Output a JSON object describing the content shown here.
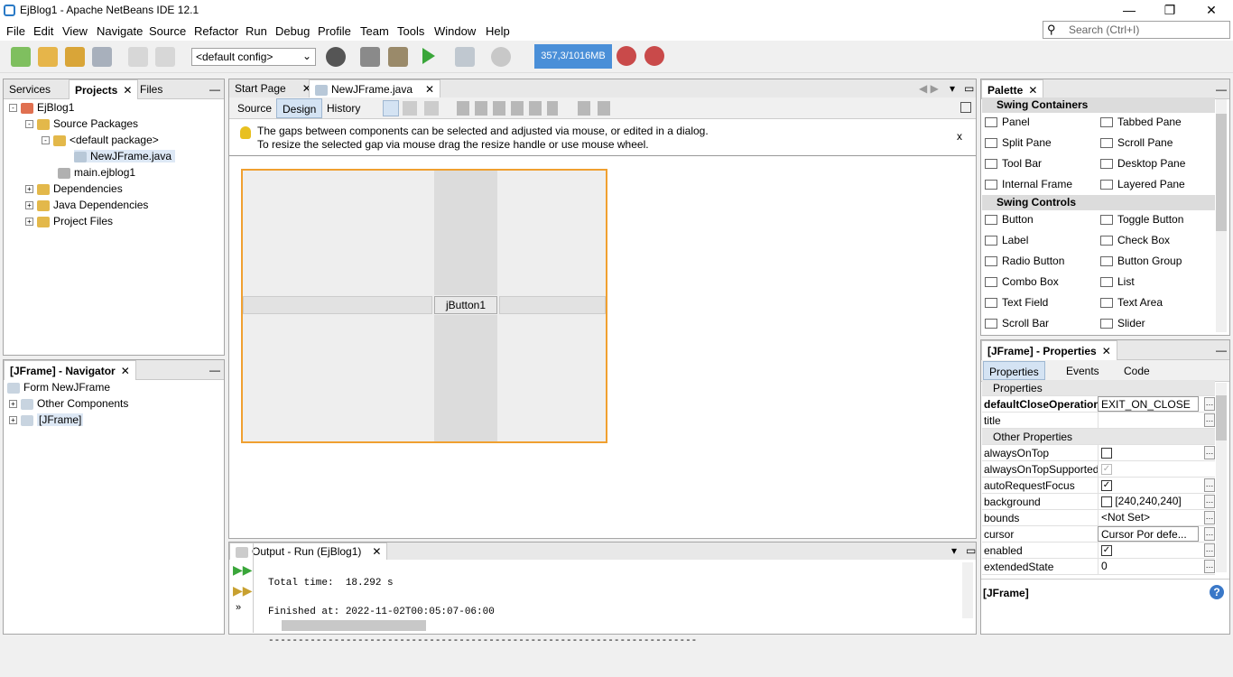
{
  "window": {
    "title": "EjBlog1 - Apache NetBeans IDE 12.1",
    "minimize": "—",
    "restore": "❐",
    "close": "✕"
  },
  "menu": [
    "File",
    "Edit",
    "View",
    "Navigate",
    "Source",
    "Refactor",
    "Run",
    "Debug",
    "Profile",
    "Team",
    "Tools",
    "Window",
    "Help"
  ],
  "search": {
    "placeholder": "Search (Ctrl+I)"
  },
  "toolbar": {
    "config": "<default config>",
    "memory": "357,3/1016MB"
  },
  "projects_panel": {
    "tabs": [
      "Services",
      "Projects",
      "Files"
    ],
    "tree": [
      "EjBlog1",
      "Source Packages",
      "<default package>",
      "NewJFrame.java",
      "main.ejblog1",
      "Dependencies",
      "Java Dependencies",
      "Project Files"
    ]
  },
  "navigator": {
    "title": "[JFrame] - Navigator",
    "tree": [
      "Form NewJFrame",
      "Other Components",
      "[JFrame]"
    ]
  },
  "editor": {
    "tabs": [
      "Start Page",
      "NewJFrame.java"
    ],
    "modes": [
      "Source",
      "Design",
      "History"
    ],
    "hint1": "The gaps between components can be selected and adjusted via mouse, or edited in a dialog.",
    "hint2": "To resize the selected gap via mouse drag the resize handle or use mouse wheel.",
    "hint_close": "x",
    "button": "jButton1"
  },
  "output": {
    "title": "Output - Run (EjBlog1)",
    "lines": [
      "Total time:  18.292 s",
      "Finished at: 2022-11-02T00:05:07-06:00",
      "------------------------------------------------------------------------"
    ]
  },
  "palette": {
    "title": "Palette",
    "cat1": "Swing Containers",
    "containers": [
      "Panel",
      "Tabbed Pane",
      "Split Pane",
      "Scroll Pane",
      "Tool Bar",
      "Desktop Pane",
      "Internal Frame",
      "Layered Pane"
    ],
    "cat2": "Swing Controls",
    "controls": [
      "Button",
      "Toggle Button",
      "Label",
      "Check Box",
      "Radio Button",
      "Button Group",
      "Combo Box",
      "List",
      "Text Field",
      "Text Area",
      "Scroll Bar",
      "Slider"
    ]
  },
  "properties": {
    "title": "[JFrame] - Properties",
    "tabs": [
      "Properties",
      "Events",
      "Code"
    ],
    "section1": "Properties",
    "section2": "Other Properties",
    "rows": [
      {
        "name": "defaultCloseOperation",
        "value": "EXIT_ON_CLOSE"
      },
      {
        "name": "title",
        "value": ""
      },
      {
        "name": "alwaysOnTop",
        "value": ""
      },
      {
        "name": "alwaysOnTopSupported",
        "value": "✓"
      },
      {
        "name": "autoRequestFocus",
        "value": "✓"
      },
      {
        "name": "background",
        "value": "[240,240,240]"
      },
      {
        "name": "bounds",
        "value": "<Not Set>"
      },
      {
        "name": "cursor",
        "value": "Cursor Por defe..."
      },
      {
        "name": "enabled",
        "value": "✓"
      },
      {
        "name": "extendedState",
        "value": "0"
      }
    ],
    "footer": "[JFrame]"
  },
  "colors": {
    "memory": "#4a8fd8",
    "selection_orange": "#f0a030"
  }
}
